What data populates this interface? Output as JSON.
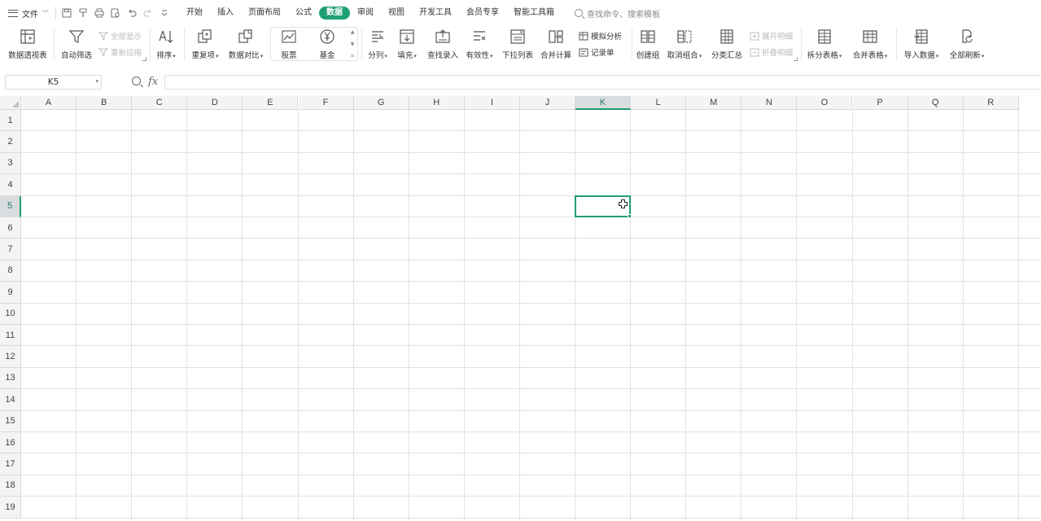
{
  "menu": {
    "file_label": "文件"
  },
  "quick_access": [
    "save-icon",
    "format-painter-icon",
    "print-icon",
    "print-preview-icon",
    "undo-icon",
    "redo-icon",
    "more-icon"
  ],
  "tabs": [
    {
      "label": "开始"
    },
    {
      "label": "插入"
    },
    {
      "label": "页面布局"
    },
    {
      "label": "公式"
    },
    {
      "label": "数据",
      "active": true
    },
    {
      "label": "审阅"
    },
    {
      "label": "视图"
    },
    {
      "label": "开发工具"
    },
    {
      "label": "会员专享"
    },
    {
      "label": "智能工具箱"
    }
  ],
  "search": {
    "placeholder": "查找命令、搜索模板"
  },
  "ribbon": {
    "pivot": "数据透视表",
    "autofilter": "自动筛选",
    "show_all": "全部显示",
    "reapply": "重新应用",
    "sort": "排序",
    "duplicates": "重复项",
    "compare": "数据对比",
    "stock": "股票",
    "fund": "基金",
    "split_column": "分列",
    "fill": "填充",
    "find_entry": "查找录入",
    "validity": "有效性",
    "dropdown_list": "下拉列表",
    "consolidate": "合并计算",
    "what_if": "模拟分析",
    "record_form": "记录单",
    "create_group": "创建组",
    "ungroup": "取消组合",
    "subtotal": "分类汇总",
    "expand_detail": "展开明细",
    "collapse_detail": "折叠明细",
    "split_table": "拆分表格",
    "merge_table": "合并表格",
    "import_data": "导入数据",
    "refresh_all": "全部刷新"
  },
  "formula_bar": {
    "name_box": "K5",
    "fx": "fx",
    "formula": ""
  },
  "sheet": {
    "columns": [
      "A",
      "B",
      "C",
      "D",
      "E",
      "F",
      "G",
      "H",
      "I",
      "J",
      "K",
      "L",
      "M",
      "N",
      "O",
      "P",
      "Q",
      "R"
    ],
    "rows": [
      "1",
      "2",
      "3",
      "4",
      "5",
      "6",
      "7",
      "8",
      "9",
      "10",
      "11",
      "12",
      "13",
      "14",
      "15",
      "16",
      "17",
      "18",
      "19"
    ],
    "selected_column": "K",
    "selected_row": "5",
    "accent": "#1e9f74"
  }
}
